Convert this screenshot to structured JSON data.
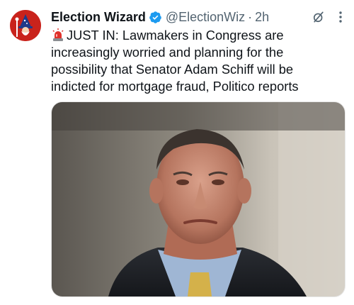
{
  "tweet": {
    "author_name": "Election Wizard",
    "handle": "@ElectionWiz",
    "separator": "·",
    "time": "2h",
    "verified": true,
    "text_lines": [
      "JUST IN: Lawmakers in Congress are",
      "increasingly worried and planning for the",
      "possibility that Senator Adam Schiff will be",
      "indicted for mortgage fraud, Politico reports"
    ],
    "leading_emoji": "rotating-light-icon",
    "media": {
      "type": "photo",
      "subject": "portrait-photo"
    }
  },
  "colors": {
    "verified_blue": "#1d9bf0",
    "secondary_text": "#536471",
    "avatar_red": "#c9231c"
  },
  "icons": {
    "avatar": "wizard-avatar-icon",
    "verified": "verified-badge-icon",
    "grok": "grok-icon",
    "more": "more-options-icon"
  }
}
